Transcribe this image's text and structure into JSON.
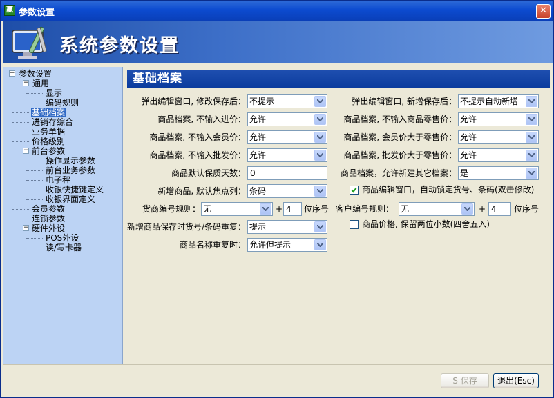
{
  "window": {
    "title": "参数设置",
    "app_icon_text": "赢"
  },
  "banner": {
    "title": "系统参数设置"
  },
  "tree": {
    "items": [
      {
        "label": "参数设置",
        "level": 0
      },
      {
        "label": "通用",
        "level": 1
      },
      {
        "label": "显示",
        "level": 2
      },
      {
        "label": "编码规则",
        "level": 2
      },
      {
        "label": "基础档案",
        "level": 1,
        "selected": true
      },
      {
        "label": "进销存综合",
        "level": 1
      },
      {
        "label": "业务单据",
        "level": 1
      },
      {
        "label": "价格级别",
        "level": 1
      },
      {
        "label": "前台参数",
        "level": 1
      },
      {
        "label": "操作显示参数",
        "level": 2
      },
      {
        "label": "前台业务参数",
        "level": 2
      },
      {
        "label": "电子秤",
        "level": 2
      },
      {
        "label": "收银快捷键定义",
        "level": 2
      },
      {
        "label": "收银界面定义",
        "level": 2
      },
      {
        "label": "会员参数",
        "level": 1
      },
      {
        "label": "连锁参数",
        "level": 1
      },
      {
        "label": "硬件外设",
        "level": 1
      },
      {
        "label": "POS外设",
        "level": 2
      },
      {
        "label": "读/写卡器",
        "level": 2
      }
    ]
  },
  "panel": {
    "header": "基础档案",
    "left": [
      {
        "label": "弹出编辑窗口, 修改保存后：",
        "value": "不提示"
      },
      {
        "label": "商品档案, 不输入进价：",
        "value": "允许"
      },
      {
        "label": "商品档案, 不输入会员价：",
        "value": "允许"
      },
      {
        "label": "商品档案, 不输入批发价：",
        "value": "允许"
      },
      {
        "label": "商品默认保质天数：",
        "value": "0"
      },
      {
        "label": "新增商品, 默认焦点列：",
        "value": "条码"
      }
    ],
    "right": [
      {
        "label": "弹出编辑窗口, 新增保存后：",
        "value": "不提示自动新增"
      },
      {
        "label": "商品档案, 不输入商品零售价：",
        "value": "允许"
      },
      {
        "label": "商品档案, 会员价大于零售价：",
        "value": "允许"
      },
      {
        "label": "商品档案, 批发价大于零售价：",
        "value": "允许"
      },
      {
        "label": "商品档案，允许新建其它档案：",
        "value": "是"
      }
    ],
    "auto_lock": {
      "label": "商品编辑窗口，自动锁定货号、条码(双击修改)",
      "checked": true
    },
    "supplier_rule": {
      "label": "货商编号规则：",
      "value": "无",
      "plus": "+",
      "digits": "4",
      "suffix": "位序号"
    },
    "customer_rule": {
      "label": "客户编号规则：",
      "value": "无",
      "plus": "+",
      "digits": "4",
      "suffix": "位序号"
    },
    "price_round": {
      "label": "商品价格, 保留两位小数(四舍五入)",
      "checked": false
    },
    "dup_barcode": {
      "label": "新增商品保存时货号/条码重复：",
      "value": "提示"
    },
    "dup_name": {
      "label": "商品名称重复时：",
      "value": "允许但提示"
    }
  },
  "footer": {
    "save_label": "S 保存",
    "exit_label": "退出(Esc)"
  }
}
